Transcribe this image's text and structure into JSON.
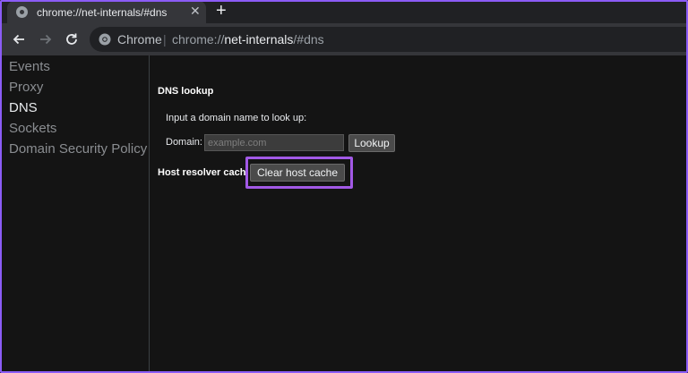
{
  "browser": {
    "tab": {
      "title": "chrome://net-internals/#dns",
      "close_icon": "close-icon"
    },
    "new_tab_label": "+",
    "toolbar": {
      "site_label": "Chrome",
      "separator": "|",
      "url_prefix": "chrome://",
      "url_host": "net-internals",
      "url_suffix": "/#dns"
    }
  },
  "sidebar": {
    "items": [
      {
        "label": "Events",
        "active": false
      },
      {
        "label": "Proxy",
        "active": false
      },
      {
        "label": "DNS",
        "active": true
      },
      {
        "label": "Sockets",
        "active": false
      },
      {
        "label": "Domain Security Policy",
        "active": false
      }
    ]
  },
  "dns": {
    "lookup_heading": "DNS lookup",
    "prompt": "Input a domain name to look up:",
    "domain_label": "Domain:",
    "domain_placeholder": "example.com",
    "lookup_button": "Lookup",
    "resolver_heading": "Host resolver cache",
    "clear_button": "Clear host cache"
  },
  "colors": {
    "highlight": "#a259e6",
    "frame": "#8b5cf6",
    "background": "#141414"
  }
}
